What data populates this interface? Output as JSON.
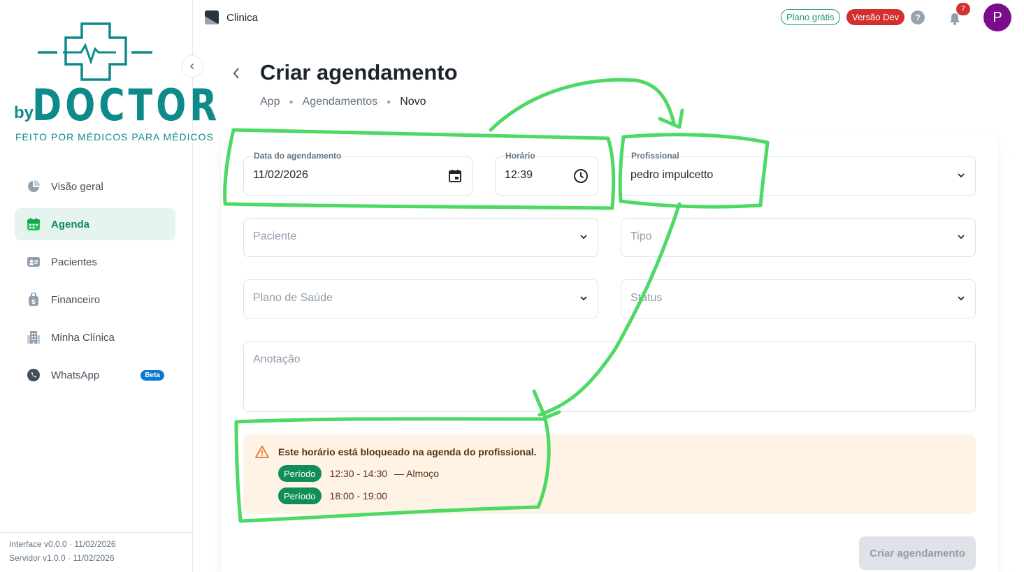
{
  "sidebar": {
    "logo": {
      "by": "by",
      "name": "DOCTOR",
      "tagline": "FEITO POR MÉDICOS PARA MÉDICOS"
    },
    "items": [
      {
        "label": "Visão geral",
        "icon": "pie-chart-icon"
      },
      {
        "label": "Agenda",
        "icon": "calendar-icon",
        "active": true
      },
      {
        "label": "Pacientes",
        "icon": "id-card-icon"
      },
      {
        "label": "Financeiro",
        "icon": "money-bag-icon"
      },
      {
        "label": "Minha Clínica",
        "icon": "building-icon"
      },
      {
        "label": "WhatsApp",
        "icon": "whatsapp-icon",
        "badge": "Beta"
      }
    ],
    "version": {
      "interface": "Interface v0.0.0 · 11/02/2026",
      "server": "Servidor v1.0.0 · 11/02/2026"
    }
  },
  "topbar": {
    "clinic": "Clinica",
    "plan_badge": "Plano grátis",
    "dev_badge": "Versão Dev",
    "help": "?",
    "notifications": "7",
    "avatar": "P"
  },
  "header": {
    "title": "Criar agendamento",
    "breadcrumb": [
      "App",
      "Agendamentos",
      "Novo"
    ]
  },
  "form": {
    "date": {
      "label": "Data do agendamento",
      "value": "11/02/2026"
    },
    "time": {
      "label": "Horário",
      "value": "12:39"
    },
    "professional": {
      "label": "Profissional",
      "value": "pedro impulcetto"
    },
    "patient": {
      "placeholder": "Paciente"
    },
    "type": {
      "placeholder": "Tipo"
    },
    "health_plan": {
      "placeholder": "Plano de Saúde"
    },
    "status": {
      "placeholder": "Status"
    },
    "notes": {
      "placeholder": "Anotação"
    }
  },
  "alert": {
    "title": "Este horário está bloqueado na agenda do profissional.",
    "periods": [
      {
        "chip": "Período",
        "range": "12:30 - 14:30",
        "label": "— Almoço"
      },
      {
        "chip": "Período",
        "range": "18:00 - 19:00",
        "label": ""
      }
    ]
  },
  "submit_label": "Criar agendamento",
  "colors": {
    "brand": "#0e8a8a",
    "active_nav": "#0f8a5f",
    "alert_bg": "#fff3e5",
    "chip": "#118d57",
    "annotation": "#4cd964"
  }
}
